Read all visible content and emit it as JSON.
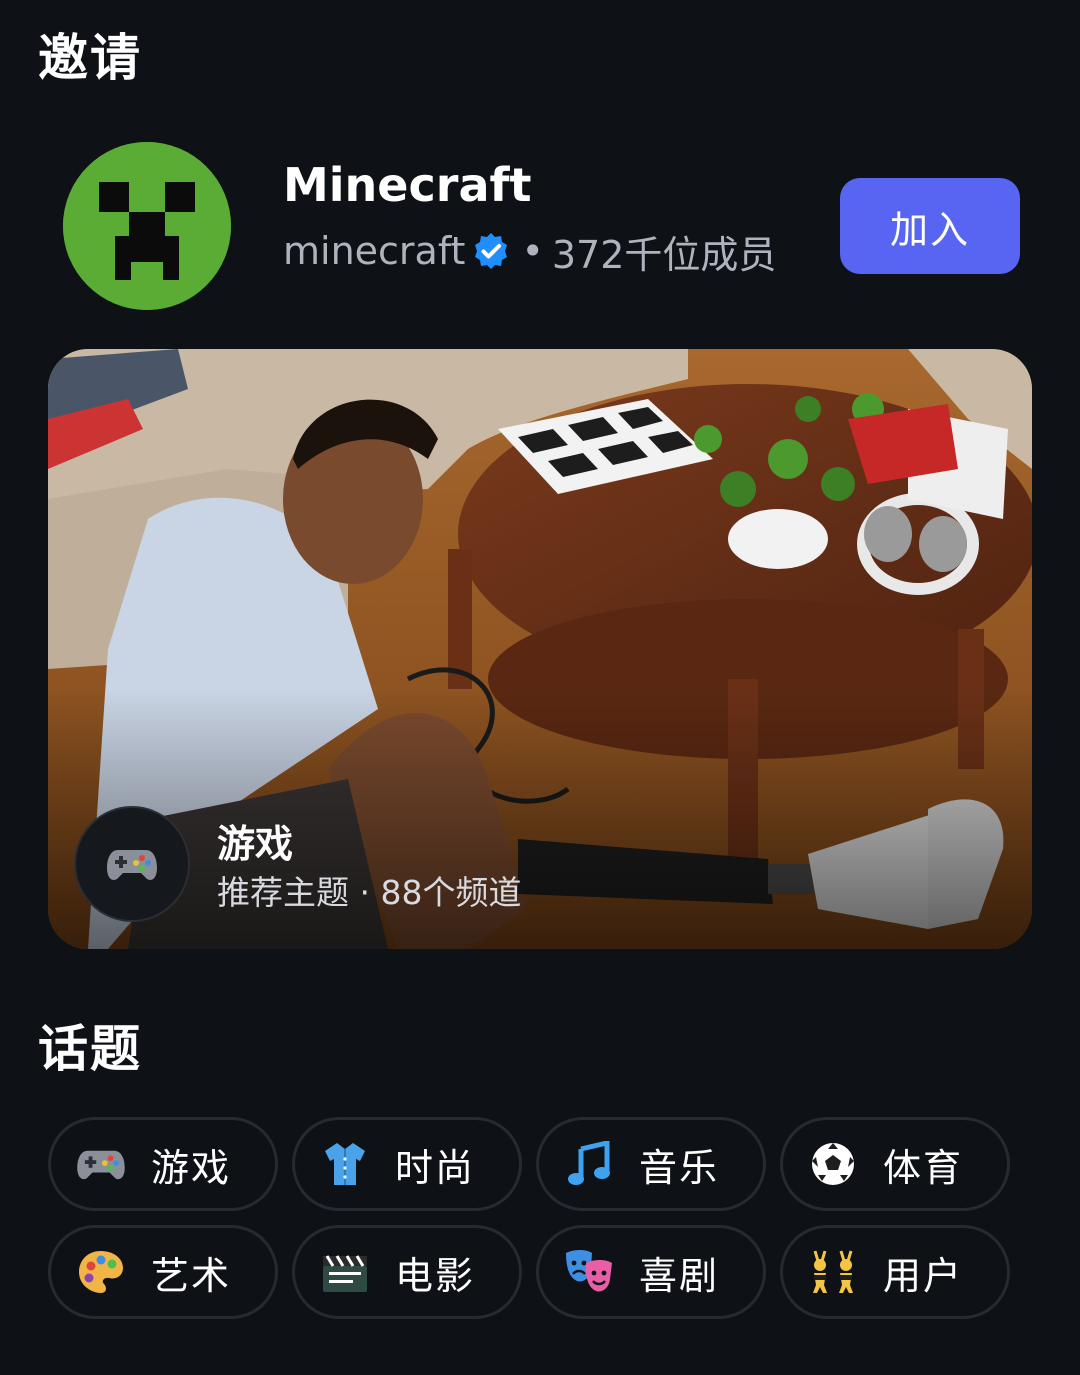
{
  "invite": {
    "title": "邀请",
    "community": {
      "name": "Minecraft",
      "handle": "minecraft",
      "separator": "•",
      "members": "372千位成员",
      "join_label": "加入",
      "avatar_icon": "minecraft-creeper-icon",
      "verified_icon": "verified-badge-icon",
      "accent_color": "#5865f2"
    },
    "banner": {
      "title": "游戏",
      "subtitle": "推荐主题 · 88个频道",
      "icon": "game-controller-icon"
    }
  },
  "topics": {
    "title": "话题",
    "items": [
      {
        "label": "游戏",
        "icon": "game-controller-icon"
      },
      {
        "label": "时尚",
        "icon": "shirt-icon"
      },
      {
        "label": "音乐",
        "icon": "music-note-icon"
      },
      {
        "label": "体育",
        "icon": "soccer-ball-icon"
      },
      {
        "label": "艺术",
        "icon": "palette-icon"
      },
      {
        "label": "电影",
        "icon": "clapperboard-icon"
      },
      {
        "label": "喜剧",
        "icon": "theater-masks-icon"
      },
      {
        "label": "用户",
        "icon": "people-bunny-ears-icon"
      }
    ]
  }
}
